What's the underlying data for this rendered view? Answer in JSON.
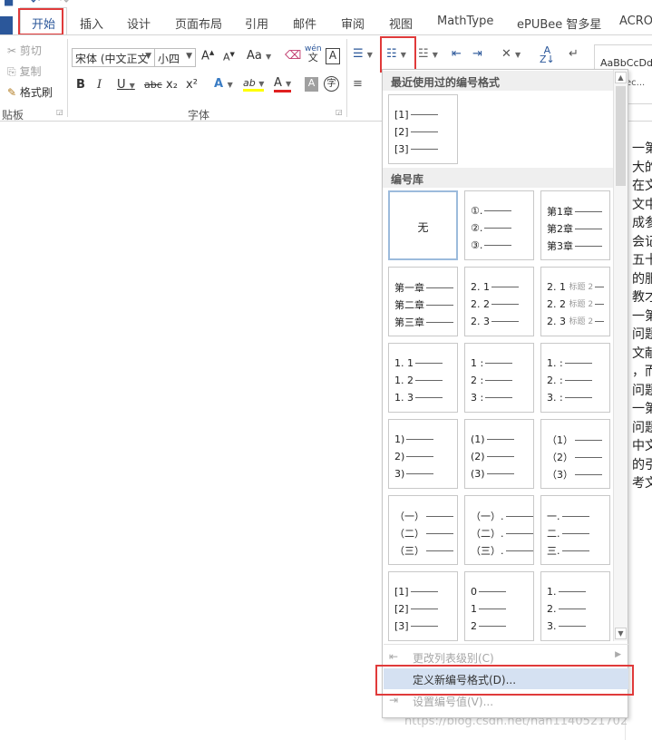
{
  "tabs": {
    "home": "开始",
    "insert": "插入",
    "design": "设计",
    "layout": "页面布局",
    "references": "引用",
    "mailings": "邮件",
    "review": "审阅",
    "view": "视图",
    "mathtype": "MathType",
    "epubee": "ePUBee 智多星",
    "acro": "ACRO"
  },
  "clipboard": {
    "cut": "剪切",
    "copy": "复制",
    "format_painter": "格式刷",
    "label": "贴板"
  },
  "font": {
    "name": "宋体 (中文正文",
    "size": "小四",
    "label": "字体",
    "grow": "A",
    "shrink": "A",
    "case": "Aa",
    "phonetic_top": "wén",
    "phonetic_bottom": "文",
    "border_char": "A",
    "bold": "B",
    "italic": "I",
    "underline": "U",
    "strike": "abc",
    "subscript": "x₂",
    "superscript": "x²",
    "effects": "A",
    "highlight": "ab",
    "font_color": "A",
    "shading": "A",
    "enclose": "字"
  },
  "styles": {
    "preview": "AaBbCcDdI",
    "second": "ec..."
  },
  "dropdown": {
    "recent_header": "最近使用过的编号格式",
    "library_header": "编号库",
    "recent_tile": [
      "[1]",
      "[2]",
      "[3]"
    ],
    "none_label": "无",
    "library_tiles": [
      [
        "①.",
        "②.",
        "③."
      ],
      [
        "第1章",
        "第2章",
        "第3章"
      ],
      [
        "第一章",
        "第二章",
        "第三章"
      ],
      [
        "2. 1",
        "2. 2",
        "2. 3"
      ],
      [
        "2. 1",
        "2. 2",
        "2. 3"
      ],
      [
        "1. 1",
        "1. 2",
        "1. 3"
      ],
      [
        "1 :",
        "2 :",
        "3 :"
      ],
      [
        "1. :",
        "2. :",
        "3. :"
      ],
      [
        "1)",
        "2)",
        "3)"
      ],
      [
        "(1)",
        "(2)",
        "(3)"
      ],
      [
        "（1）",
        "（2）",
        "（3）"
      ],
      [
        "（一）",
        "（二）",
        "（三）"
      ],
      [
        "（一）.",
        "（二）.",
        "（三）."
      ],
      [
        "一.",
        "二.",
        "三."
      ],
      [
        "[1]",
        "[2]",
        "[3]"
      ],
      [
        "0",
        "1",
        "2"
      ],
      [
        "1.",
        "2.",
        "3."
      ]
    ],
    "heading_sub": "标题 2",
    "change_level": "更改列表级别(C)",
    "define_new": "定义新编号格式(D)...",
    "set_value": "设置编号值(V)..."
  },
  "document": {
    "lines": [
      "一第",
      "大的",
      "在文",
      "文中",
      "成参",
      "会记",
      "五十",
      "的服",
      "教才",
      "一第",
      "问题",
      "文献",
      "，而",
      "问题",
      "一第",
      "问题",
      "中文",
      "的引",
      "考文"
    ]
  },
  "watermark": "https://blog.csdn.net/han1140521702"
}
